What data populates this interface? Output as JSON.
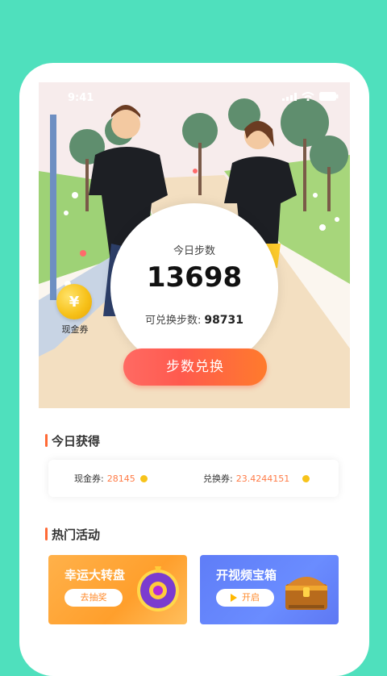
{
  "status": {
    "time": "9:41"
  },
  "hero": {
    "coin_label": "现金券",
    "coin_symbol": "¥",
    "today_steps_label": "今日步数",
    "today_steps": "13698",
    "exchangeable_label": "可兑换步数:",
    "exchangeable_value": "98731",
    "exchange_button": "步数兑换"
  },
  "today": {
    "title": "今日获得",
    "cash_label": "现金券:",
    "cash_value": "28145",
    "voucher_label": "兑换券:",
    "voucher_value": "23.4244151"
  },
  "activities": {
    "title": "热门活动",
    "items": [
      {
        "title": "幸运大转盘",
        "button": "去抽奖"
      },
      {
        "title": "开视频宝箱",
        "button": "开启"
      }
    ]
  }
}
